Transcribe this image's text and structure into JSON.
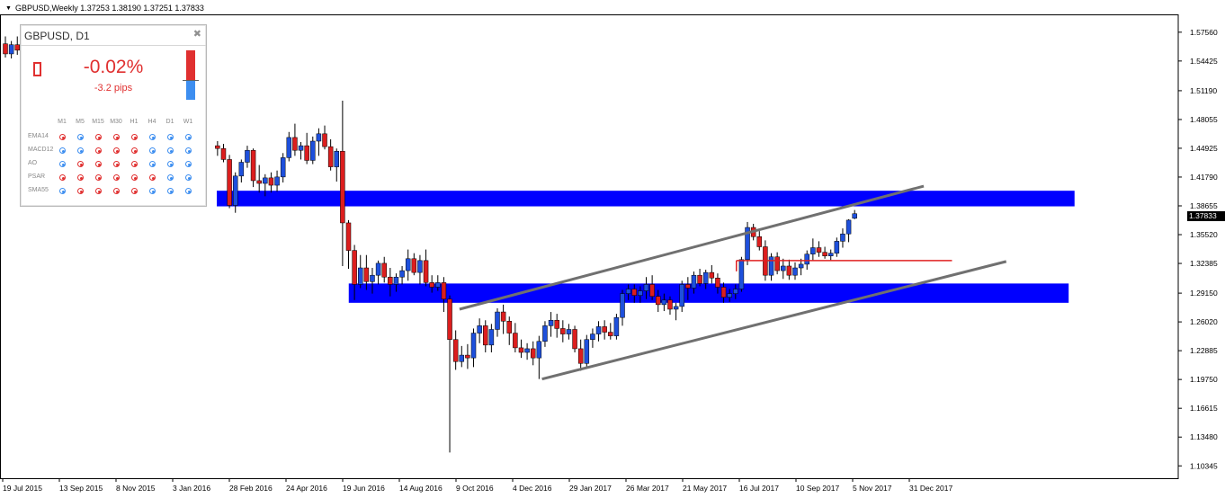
{
  "header": {
    "symbol_info": "GBPUSD,Weekly  1.37253 1.38190 1.37251 1.37833"
  },
  "chart_data": {
    "type": "candlestick",
    "ylim": [
      1.09,
      1.595
    ],
    "y_ticks": [
      "1.57560",
      "1.54425",
      "1.51190",
      "1.48055",
      "1.44925",
      "1.41790",
      "1.38655",
      "1.35520",
      "1.32385",
      "1.29150",
      "1.26020",
      "1.22885",
      "1.19750",
      "1.16615",
      "1.13480",
      "1.10345"
    ],
    "x_ticks": [
      "19 Jul 2015",
      "13 Sep 2015",
      "8 Nov 2015",
      "3 Jan 2016",
      "28 Feb 2016",
      "24 Apr 2016",
      "19 Jun 2016",
      "14 Aug 2016",
      "9 Oct 2016",
      "4 Dec 2016",
      "29 Jan 2017",
      "26 Mar 2017",
      "21 May 2017",
      "16 Jul 2017",
      "10 Sep 2017",
      "5 Nov 2017",
      "31 Dec 2017"
    ],
    "current_price": "1.37833",
    "colors": {
      "bull": "#1e50dc",
      "bear": "#dc1e1e",
      "zone": "#0000ff",
      "channel": "#707070",
      "level": "#e02020"
    },
    "candles": [
      {
        "o": 1.563,
        "h": 1.571,
        "l": 1.548,
        "c": 1.552
      },
      {
        "o": 1.552,
        "h": 1.566,
        "l": 1.547,
        "c": 1.562
      },
      {
        "o": 1.562,
        "h": 1.571,
        "l": 1.551,
        "c": 1.556
      },
      {
        "o": 1.452,
        "h": 1.457,
        "l": 1.441,
        "c": 1.449
      },
      {
        "o": 1.449,
        "h": 1.454,
        "l": 1.434,
        "c": 1.437
      },
      {
        "o": 1.437,
        "h": 1.442,
        "l": 1.384,
        "c": 1.387
      },
      {
        "o": 1.387,
        "h": 1.423,
        "l": 1.379,
        "c": 1.419
      },
      {
        "o": 1.419,
        "h": 1.437,
        "l": 1.412,
        "c": 1.434
      },
      {
        "o": 1.434,
        "h": 1.452,
        "l": 1.428,
        "c": 1.447
      },
      {
        "o": 1.447,
        "h": 1.449,
        "l": 1.407,
        "c": 1.414
      },
      {
        "o": 1.414,
        "h": 1.431,
        "l": 1.401,
        "c": 1.411
      },
      {
        "o": 1.411,
        "h": 1.421,
        "l": 1.397,
        "c": 1.417
      },
      {
        "o": 1.417,
        "h": 1.423,
        "l": 1.401,
        "c": 1.409
      },
      {
        "o": 1.409,
        "h": 1.425,
        "l": 1.402,
        "c": 1.418
      },
      {
        "o": 1.418,
        "h": 1.444,
        "l": 1.412,
        "c": 1.439
      },
      {
        "o": 1.439,
        "h": 1.467,
        "l": 1.435,
        "c": 1.461
      },
      {
        "o": 1.461,
        "h": 1.476,
        "l": 1.441,
        "c": 1.447
      },
      {
        "o": 1.447,
        "h": 1.456,
        "l": 1.437,
        "c": 1.452
      },
      {
        "o": 1.452,
        "h": 1.466,
        "l": 1.432,
        "c": 1.436
      },
      {
        "o": 1.436,
        "h": 1.462,
        "l": 1.432,
        "c": 1.457
      },
      {
        "o": 1.457,
        "h": 1.471,
        "l": 1.441,
        "c": 1.465
      },
      {
        "o": 1.465,
        "h": 1.474,
        "l": 1.448,
        "c": 1.451
      },
      {
        "o": 1.451,
        "h": 1.459,
        "l": 1.425,
        "c": 1.429
      },
      {
        "o": 1.429,
        "h": 1.449,
        "l": 1.413,
        "c": 1.446
      },
      {
        "o": 1.446,
        "h": 1.501,
        "l": 1.321,
        "c": 1.368
      },
      {
        "o": 1.368,
        "h": 1.371,
        "l": 1.318,
        "c": 1.338
      },
      {
        "o": 1.338,
        "h": 1.344,
        "l": 1.284,
        "c": 1.301
      },
      {
        "o": 1.301,
        "h": 1.333,
        "l": 1.297,
        "c": 1.319
      },
      {
        "o": 1.319,
        "h": 1.333,
        "l": 1.295,
        "c": 1.304
      },
      {
        "o": 1.304,
        "h": 1.319,
        "l": 1.291,
        "c": 1.311
      },
      {
        "o": 1.311,
        "h": 1.327,
        "l": 1.301,
        "c": 1.324
      },
      {
        "o": 1.324,
        "h": 1.331,
        "l": 1.303,
        "c": 1.309
      },
      {
        "o": 1.309,
        "h": 1.319,
        "l": 1.288,
        "c": 1.301
      },
      {
        "o": 1.301,
        "h": 1.313,
        "l": 1.293,
        "c": 1.309
      },
      {
        "o": 1.309,
        "h": 1.321,
        "l": 1.301,
        "c": 1.316
      },
      {
        "o": 1.316,
        "h": 1.339,
        "l": 1.305,
        "c": 1.329
      },
      {
        "o": 1.329,
        "h": 1.335,
        "l": 1.311,
        "c": 1.314
      },
      {
        "o": 1.314,
        "h": 1.333,
        "l": 1.301,
        "c": 1.327
      },
      {
        "o": 1.327,
        "h": 1.339,
        "l": 1.299,
        "c": 1.303
      },
      {
        "o": 1.303,
        "h": 1.311,
        "l": 1.292,
        "c": 1.298
      },
      {
        "o": 1.298,
        "h": 1.311,
        "l": 1.294,
        "c": 1.303
      },
      {
        "o": 1.303,
        "h": 1.309,
        "l": 1.271,
        "c": 1.285
      },
      {
        "o": 1.285,
        "h": 1.289,
        "l": 1.118,
        "c": 1.241
      },
      {
        "o": 1.241,
        "h": 1.251,
        "l": 1.208,
        "c": 1.217
      },
      {
        "o": 1.217,
        "h": 1.234,
        "l": 1.211,
        "c": 1.224
      },
      {
        "o": 1.224,
        "h": 1.236,
        "l": 1.209,
        "c": 1.221
      },
      {
        "o": 1.221,
        "h": 1.253,
        "l": 1.211,
        "c": 1.248
      },
      {
        "o": 1.248,
        "h": 1.264,
        "l": 1.237,
        "c": 1.256
      },
      {
        "o": 1.256,
        "h": 1.262,
        "l": 1.227,
        "c": 1.235
      },
      {
        "o": 1.235,
        "h": 1.258,
        "l": 1.227,
        "c": 1.252
      },
      {
        "o": 1.252,
        "h": 1.275,
        "l": 1.244,
        "c": 1.271
      },
      {
        "o": 1.271,
        "h": 1.279,
        "l": 1.247,
        "c": 1.261
      },
      {
        "o": 1.261,
        "h": 1.266,
        "l": 1.235,
        "c": 1.248
      },
      {
        "o": 1.248,
        "h": 1.259,
        "l": 1.227,
        "c": 1.232
      },
      {
        "o": 1.232,
        "h": 1.241,
        "l": 1.221,
        "c": 1.227
      },
      {
        "o": 1.227,
        "h": 1.237,
        "l": 1.219,
        "c": 1.231
      },
      {
        "o": 1.231,
        "h": 1.239,
        "l": 1.213,
        "c": 1.221
      },
      {
        "o": 1.221,
        "h": 1.245,
        "l": 1.198,
        "c": 1.239
      },
      {
        "o": 1.239,
        "h": 1.261,
        "l": 1.233,
        "c": 1.256
      },
      {
        "o": 1.256,
        "h": 1.271,
        "l": 1.244,
        "c": 1.262
      },
      {
        "o": 1.262,
        "h": 1.269,
        "l": 1.243,
        "c": 1.253
      },
      {
        "o": 1.253,
        "h": 1.262,
        "l": 1.238,
        "c": 1.247
      },
      {
        "o": 1.247,
        "h": 1.258,
        "l": 1.241,
        "c": 1.252
      },
      {
        "o": 1.252,
        "h": 1.256,
        "l": 1.227,
        "c": 1.231
      },
      {
        "o": 1.231,
        "h": 1.241,
        "l": 1.207,
        "c": 1.215
      },
      {
        "o": 1.215,
        "h": 1.246,
        "l": 1.209,
        "c": 1.241
      },
      {
        "o": 1.241,
        "h": 1.253,
        "l": 1.232,
        "c": 1.247
      },
      {
        "o": 1.247,
        "h": 1.261,
        "l": 1.239,
        "c": 1.255
      },
      {
        "o": 1.255,
        "h": 1.262,
        "l": 1.241,
        "c": 1.249
      },
      {
        "o": 1.249,
        "h": 1.259,
        "l": 1.241,
        "c": 1.245
      },
      {
        "o": 1.245,
        "h": 1.269,
        "l": 1.241,
        "c": 1.265
      },
      {
        "o": 1.265,
        "h": 1.295,
        "l": 1.256,
        "c": 1.291
      },
      {
        "o": 1.291,
        "h": 1.301,
        "l": 1.284,
        "c": 1.296
      },
      {
        "o": 1.296,
        "h": 1.301,
        "l": 1.281,
        "c": 1.289
      },
      {
        "o": 1.289,
        "h": 1.299,
        "l": 1.281,
        "c": 1.294
      },
      {
        "o": 1.294,
        "h": 1.309,
        "l": 1.285,
        "c": 1.301
      },
      {
        "o": 1.301,
        "h": 1.311,
        "l": 1.284,
        "c": 1.288
      },
      {
        "o": 1.288,
        "h": 1.295,
        "l": 1.271,
        "c": 1.279
      },
      {
        "o": 1.279,
        "h": 1.291,
        "l": 1.272,
        "c": 1.284
      },
      {
        "o": 1.284,
        "h": 1.288,
        "l": 1.268,
        "c": 1.274
      },
      {
        "o": 1.274,
        "h": 1.281,
        "l": 1.262,
        "c": 1.277
      },
      {
        "o": 1.277,
        "h": 1.305,
        "l": 1.271,
        "c": 1.301
      },
      {
        "o": 1.301,
        "h": 1.309,
        "l": 1.284,
        "c": 1.297
      },
      {
        "o": 1.297,
        "h": 1.315,
        "l": 1.291,
        "c": 1.311
      },
      {
        "o": 1.311,
        "h": 1.318,
        "l": 1.299,
        "c": 1.302
      },
      {
        "o": 1.302,
        "h": 1.317,
        "l": 1.296,
        "c": 1.314
      },
      {
        "o": 1.314,
        "h": 1.322,
        "l": 1.302,
        "c": 1.308
      },
      {
        "o": 1.308,
        "h": 1.313,
        "l": 1.291,
        "c": 1.298
      },
      {
        "o": 1.298,
        "h": 1.303,
        "l": 1.281,
        "c": 1.287
      },
      {
        "o": 1.287,
        "h": 1.296,
        "l": 1.282,
        "c": 1.291
      },
      {
        "o": 1.291,
        "h": 1.301,
        "l": 1.285,
        "c": 1.296
      },
      {
        "o": 1.296,
        "h": 1.331,
        "l": 1.293,
        "c": 1.328
      },
      {
        "o": 1.328,
        "h": 1.369,
        "l": 1.322,
        "c": 1.363
      },
      {
        "o": 1.363,
        "h": 1.367,
        "l": 1.349,
        "c": 1.353
      },
      {
        "o": 1.353,
        "h": 1.359,
        "l": 1.338,
        "c": 1.342
      },
      {
        "o": 1.342,
        "h": 1.349,
        "l": 1.305,
        "c": 1.311
      },
      {
        "o": 1.311,
        "h": 1.335,
        "l": 1.305,
        "c": 1.331
      },
      {
        "o": 1.331,
        "h": 1.336,
        "l": 1.312,
        "c": 1.316
      },
      {
        "o": 1.316,
        "h": 1.329,
        "l": 1.307,
        "c": 1.321
      },
      {
        "o": 1.321,
        "h": 1.328,
        "l": 1.306,
        "c": 1.311
      },
      {
        "o": 1.311,
        "h": 1.325,
        "l": 1.306,
        "c": 1.319
      },
      {
        "o": 1.319,
        "h": 1.329,
        "l": 1.311,
        "c": 1.323
      },
      {
        "o": 1.323,
        "h": 1.338,
        "l": 1.317,
        "c": 1.334
      },
      {
        "o": 1.334,
        "h": 1.351,
        "l": 1.327,
        "c": 1.341
      },
      {
        "o": 1.341,
        "h": 1.348,
        "l": 1.331,
        "c": 1.336
      },
      {
        "o": 1.336,
        "h": 1.342,
        "l": 1.329,
        "c": 1.332
      },
      {
        "o": 1.332,
        "h": 1.339,
        "l": 1.327,
        "c": 1.335
      },
      {
        "o": 1.335,
        "h": 1.352,
        "l": 1.331,
        "c": 1.348
      },
      {
        "o": 1.348,
        "h": 1.362,
        "l": 1.341,
        "c": 1.356
      },
      {
        "o": 1.356,
        "h": 1.372,
        "l": 1.347,
        "c": 1.371
      },
      {
        "o": 1.373,
        "h": 1.382,
        "l": 1.372,
        "c": 1.378
      }
    ],
    "zones": [
      {
        "x0": 0.184,
        "x1": 0.912,
        "y_top": 1.403,
        "y_bot": 1.386
      },
      {
        "x0": 0.296,
        "x1": 0.907,
        "y_top": 1.302,
        "y_bot": 1.281
      }
    ],
    "channel_lines": [
      {
        "x0": 0.39,
        "y0": 1.274,
        "x1": 0.784,
        "y1": 1.408
      },
      {
        "x0": 0.46,
        "y0": 1.198,
        "x1": 0.854,
        "y1": 1.326
      }
    ],
    "level_line": {
      "x0": 0.625,
      "x1": 0.808,
      "y": 1.327
    }
  },
  "panel": {
    "title": "GBPUSD, D1",
    "close_glyph": "✖",
    "change_pct": "-0.02%",
    "change_pips": "-3.2 pips",
    "timeframes": [
      "M1",
      "M5",
      "M15",
      "M30",
      "H1",
      "H4",
      "D1",
      "W1"
    ],
    "indicators": [
      {
        "name": "EMA14",
        "signals": [
          "sell",
          "buy",
          "sell",
          "sell",
          "sell",
          "buy",
          "buy",
          "buy"
        ]
      },
      {
        "name": "MACD12",
        "signals": [
          "buy",
          "buy",
          "sell",
          "sell",
          "sell",
          "buy",
          "buy",
          "buy"
        ]
      },
      {
        "name": "AO",
        "signals": [
          "buy",
          "sell",
          "sell",
          "sell",
          "sell",
          "buy",
          "buy",
          "buy"
        ]
      },
      {
        "name": "PSAR",
        "signals": [
          "sell",
          "sell",
          "sell",
          "sell",
          "sell",
          "sell",
          "buy",
          "buy"
        ]
      },
      {
        "name": "SMA55",
        "signals": [
          "buy",
          "sell",
          "sell",
          "sell",
          "sell",
          "buy",
          "buy",
          "buy"
        ]
      }
    ]
  }
}
